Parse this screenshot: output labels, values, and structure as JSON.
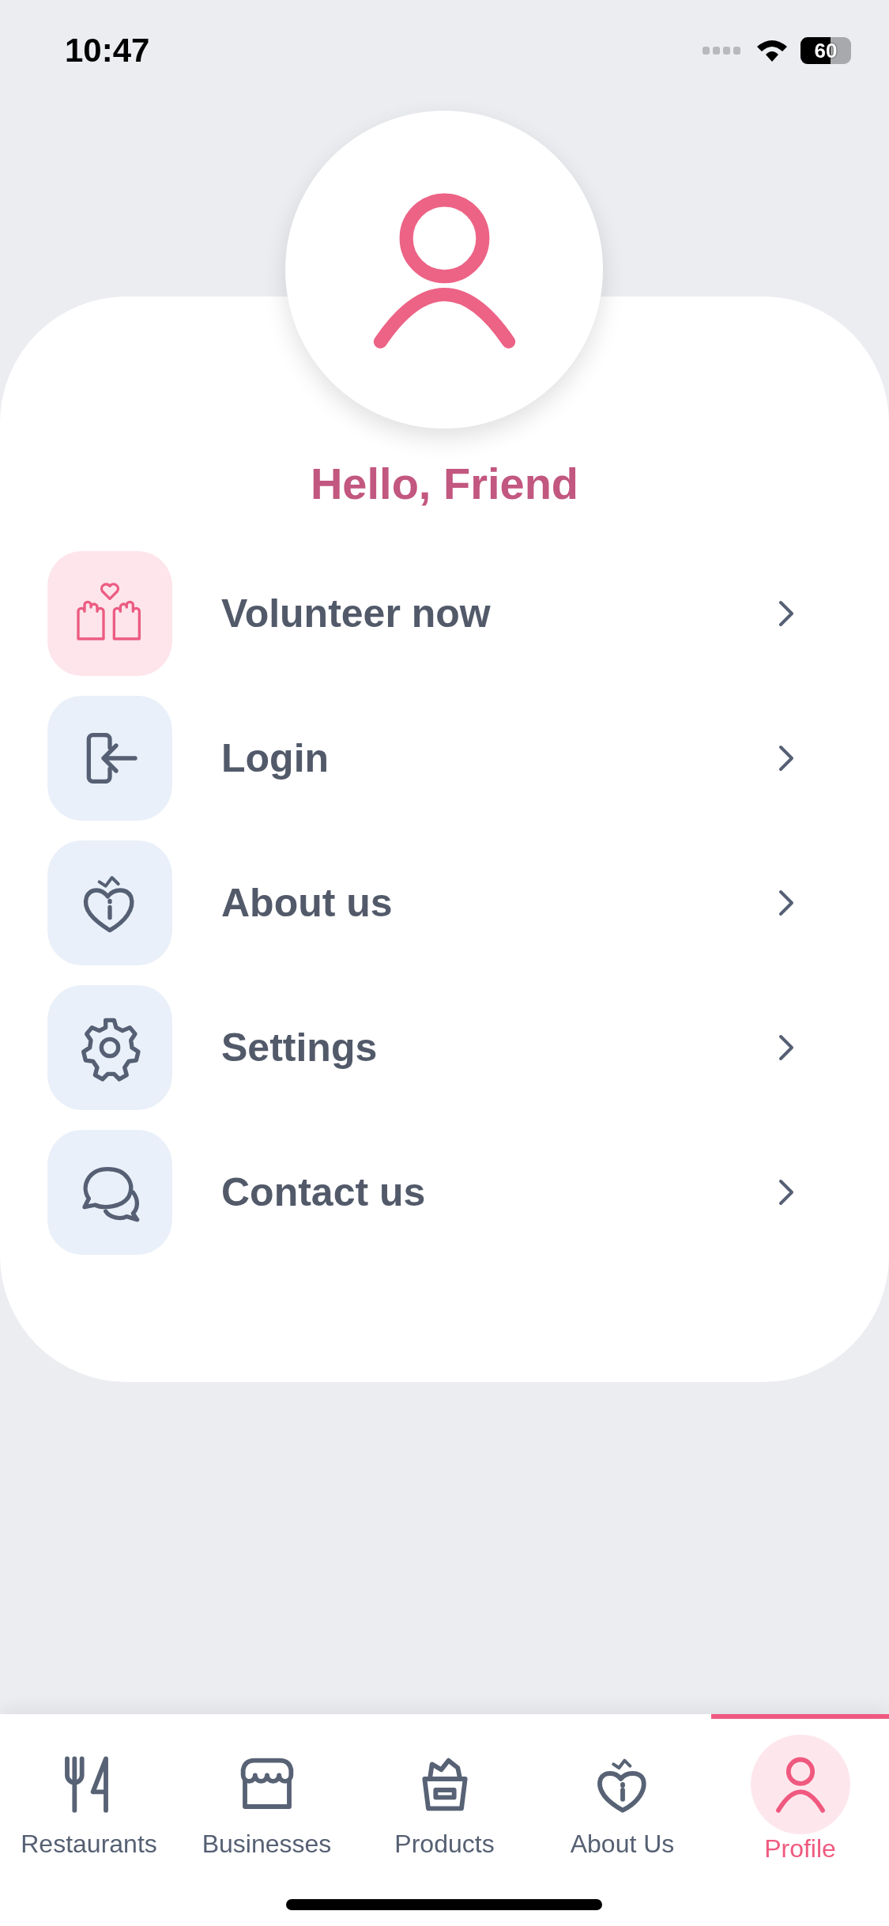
{
  "status_bar": {
    "time": "10:47",
    "battery": "60"
  },
  "profile": {
    "greeting": "Hello, Friend"
  },
  "menu": [
    {
      "label": "Volunteer now",
      "highlighted": true
    },
    {
      "label": "Login",
      "highlighted": false
    },
    {
      "label": "About us",
      "highlighted": false
    },
    {
      "label": "Settings",
      "highlighted": false
    },
    {
      "label": "Contact us",
      "highlighted": false
    }
  ],
  "tab_bar": [
    {
      "label": "Restaurants",
      "selected": false
    },
    {
      "label": "Businesses",
      "selected": false
    },
    {
      "label": "Products",
      "selected": false
    },
    {
      "label": "About Us",
      "selected": false
    },
    {
      "label": "Profile",
      "selected": true
    }
  ]
}
